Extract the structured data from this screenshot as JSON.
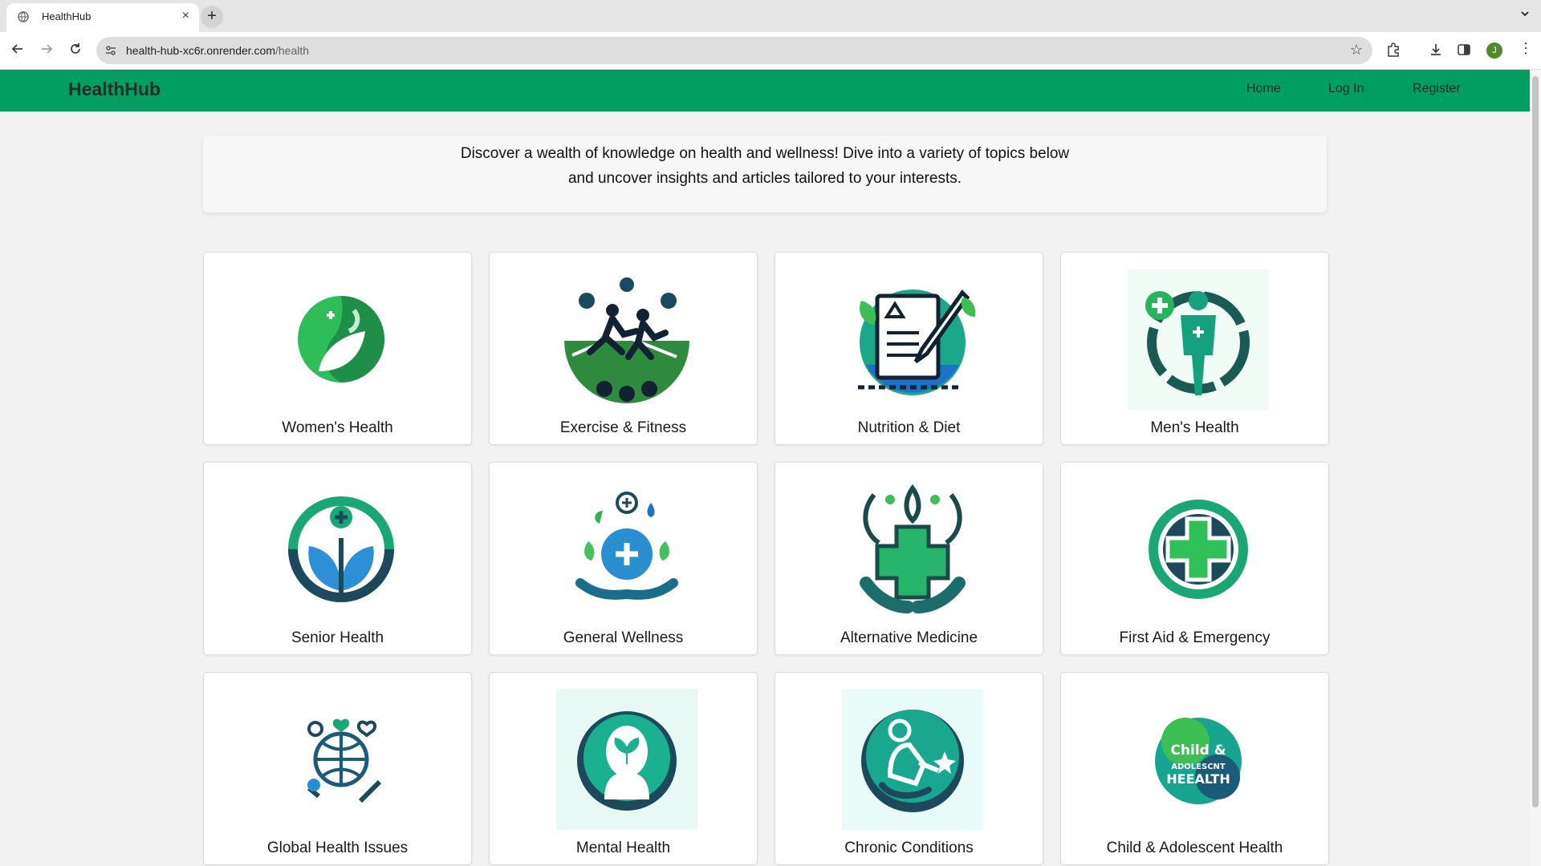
{
  "browser": {
    "tab_title": "HealthHub",
    "tab_close": "×",
    "new_tab": "+",
    "url_host": "health-hub-xc6r.onrender.com",
    "url_path": "/health",
    "profile_initial": "J"
  },
  "site": {
    "brand": "HealthHub",
    "nav": {
      "home": "Home",
      "login": "Log In",
      "register": "Register"
    },
    "accent_color": "#009e60"
  },
  "intro": {
    "line1": "Discover a wealth of knowledge on health and wellness! Dive into a variety of topics below",
    "line2": "and uncover insights and articles tailored to your interests."
  },
  "topics": [
    {
      "label": "Women's Health",
      "icon": "womens-health-icon"
    },
    {
      "label": "Exercise & Fitness",
      "icon": "exercise-fitness-icon"
    },
    {
      "label": "Nutrition & Diet",
      "icon": "nutrition-diet-icon"
    },
    {
      "label": "Men's Health",
      "icon": "mens-health-icon"
    },
    {
      "label": "Senior Health",
      "icon": "senior-health-icon"
    },
    {
      "label": "General Wellness",
      "icon": "general-wellness-icon"
    },
    {
      "label": "Alternative Medicine",
      "icon": "alternative-medicine-icon"
    },
    {
      "label": "First Aid & Emergency",
      "icon": "first-aid-icon"
    },
    {
      "label": "Global Health Issues",
      "icon": "global-health-icon"
    },
    {
      "label": "Mental Health",
      "icon": "mental-health-icon"
    },
    {
      "label": "Chronic Conditions",
      "icon": "chronic-conditions-icon"
    },
    {
      "label": "Child & Adolescent Health",
      "icon": "child-adolescent-health-icon"
    }
  ],
  "icon_badge_text": {
    "line1": "Child &",
    "line2": "ADOLESCNT",
    "line3": "HEEALTH"
  }
}
